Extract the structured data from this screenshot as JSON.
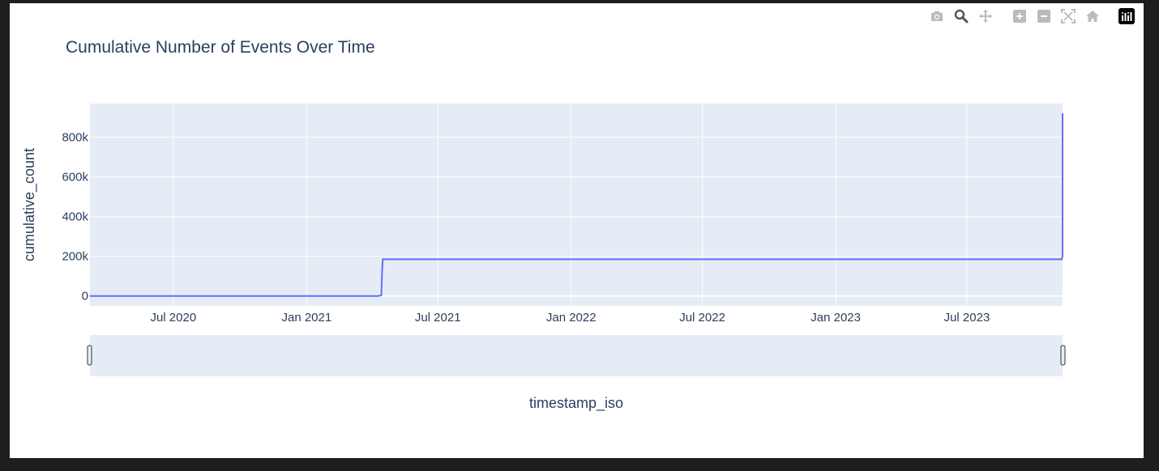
{
  "modebar": {
    "buttons": [
      {
        "name": "camera-icon",
        "color": "#bbbbbb"
      },
      {
        "name": "zoom-icon",
        "color": "#555555",
        "active": true
      },
      {
        "name": "pan-icon",
        "color": "#bbbbbb"
      },
      {
        "name": "zoom-in-icon",
        "color": "#bbbbbb"
      },
      {
        "name": "zoom-out-icon",
        "color": "#bbbbbb"
      },
      {
        "name": "autoscale-icon",
        "color": "#bbbbbb"
      },
      {
        "name": "reset-axes-icon",
        "color": "#bbbbbb"
      },
      {
        "name": "plotly-logo-icon",
        "color": "#000000"
      }
    ]
  },
  "chart_data": {
    "type": "line",
    "title": "Cumulative Number of Events Over Time",
    "xlabel": "timestamp_iso",
    "ylabel": "cumulative_count",
    "x_range": [
      "2020-03-08",
      "2023-11-10"
    ],
    "ylim": [
      -50000,
      970000
    ],
    "x_ticks": [
      {
        "date": "2020-07-01",
        "label": "Jul 2020"
      },
      {
        "date": "2021-01-01",
        "label": "Jan 2021"
      },
      {
        "date": "2021-07-01",
        "label": "Jul 2021"
      },
      {
        "date": "2022-01-01",
        "label": "Jan 2022"
      },
      {
        "date": "2022-07-01",
        "label": "Jul 2022"
      },
      {
        "date": "2023-01-01",
        "label": "Jan 2023"
      },
      {
        "date": "2023-07-01",
        "label": "Jul 2023"
      }
    ],
    "y_ticks": [
      {
        "value": 0,
        "label": "0"
      },
      {
        "value": 200000,
        "label": "200k"
      },
      {
        "value": 400000,
        "label": "400k"
      },
      {
        "value": 600000,
        "label": "600k"
      },
      {
        "value": 800000,
        "label": "800k"
      }
    ],
    "grid": true,
    "rangeslider": true,
    "series": [
      {
        "color": "#636efa",
        "x": [
          "2020-03-08",
          "2021-04-10",
          "2021-04-14",
          "2021-04-15",
          "2021-04-16",
          "2023-11-09",
          "2023-11-10",
          "2023-11-10"
        ],
        "y": [
          0,
          0,
          3000,
          120000,
          185000,
          185000,
          200000,
          920000
        ]
      }
    ]
  }
}
